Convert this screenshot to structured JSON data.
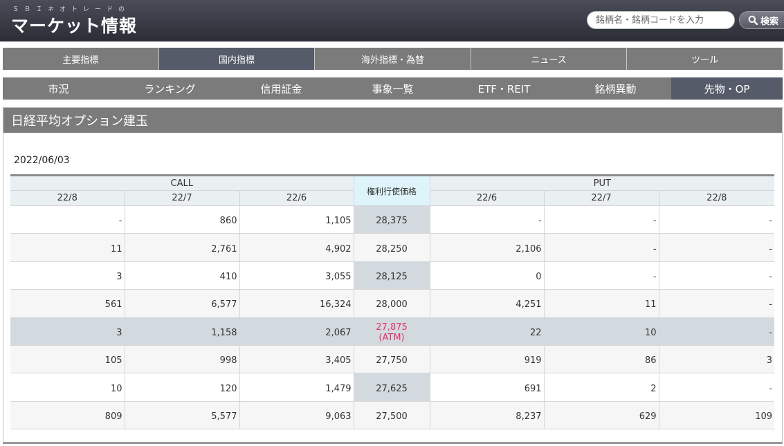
{
  "header": {
    "brand_sub": "ＳＢＩネオトレードの",
    "brand_main": "マーケット情報",
    "search_placeholder": "銘柄名・銘柄コードを入力",
    "search_button": "検索"
  },
  "main_nav": {
    "tabs": [
      {
        "label": "主要指標"
      },
      {
        "label": "国内指標"
      },
      {
        "label": "海外指標・為替"
      },
      {
        "label": "ニュース"
      },
      {
        "label": "ツール"
      }
    ],
    "active": "国内指標"
  },
  "sub_nav": {
    "tabs": [
      {
        "label": "市況"
      },
      {
        "label": "ランキング"
      },
      {
        "label": "信用証金"
      },
      {
        "label": "事象一覧"
      },
      {
        "label": "ETF・REIT"
      },
      {
        "label": "銘柄異動"
      },
      {
        "label": "先物・OP"
      }
    ],
    "active": "先物・OP"
  },
  "panel": {
    "title": "日経平均オプション建玉",
    "date": "2022/06/03"
  },
  "table": {
    "call_label": "CALL",
    "put_label": "PUT",
    "strike_label": "権利行使価格",
    "call_months": [
      "22/8",
      "22/7",
      "22/6"
    ],
    "put_months": [
      "22/6",
      "22/7",
      "22/8"
    ],
    "rows": [
      {
        "c8": "-",
        "c7": "860",
        "c6": "1,105",
        "strike": "28,375",
        "atm": "",
        "p6": "-",
        "p7": "-",
        "p8": "-"
      },
      {
        "c8": "11",
        "c7": "2,761",
        "c6": "4,902",
        "strike": "28,250",
        "atm": "",
        "p6": "2,106",
        "p7": "-",
        "p8": "-"
      },
      {
        "c8": "3",
        "c7": "410",
        "c6": "3,055",
        "strike": "28,125",
        "atm": "",
        "p6": "0",
        "p7": "-",
        "p8": "-"
      },
      {
        "c8": "561",
        "c7": "6,577",
        "c6": "16,324",
        "strike": "28,000",
        "atm": "",
        "p6": "4,251",
        "p7": "11",
        "p8": "-"
      },
      {
        "c8": "3",
        "c7": "1,158",
        "c6": "2,067",
        "strike": "27,875",
        "atm": "(ATM)",
        "p6": "22",
        "p7": "10",
        "p8": "-"
      },
      {
        "c8": "105",
        "c7": "998",
        "c6": "3,405",
        "strike": "27,750",
        "atm": "",
        "p6": "919",
        "p7": "86",
        "p8": "3"
      },
      {
        "c8": "10",
        "c7": "120",
        "c6": "1,479",
        "strike": "27,625",
        "atm": "",
        "p6": "691",
        "p7": "2",
        "p8": "-"
      },
      {
        "c8": "809",
        "c7": "5,577",
        "c6": "9,063",
        "strike": "27,500",
        "atm": "",
        "p6": "8,237",
        "p7": "629",
        "p8": "109"
      }
    ]
  },
  "colors": {
    "header_dark": "#2b2d36",
    "nav_gray": "#7b7b7b",
    "nav_active": "#555b68",
    "atm_text": "#e8306a",
    "strike_head_bg": "#dff3fb"
  }
}
